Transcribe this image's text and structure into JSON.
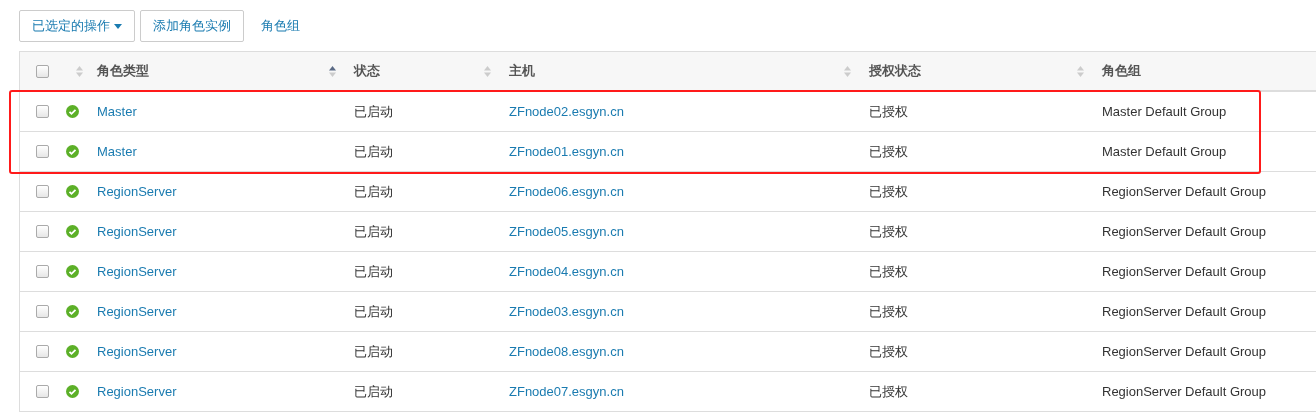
{
  "toolbar": {
    "actions_dropdown": "已选定的操作",
    "add_button": "添加角色实例",
    "group_link": "角色组"
  },
  "table": {
    "select_all_checked": false,
    "columns": [
      {
        "sorted": false
      },
      {
        "label": "角色类型",
        "sorted": true
      },
      {
        "label": "状态",
        "sorted": false
      },
      {
        "label": "主机",
        "sorted": false
      },
      {
        "label": "授权状态",
        "sorted": false
      },
      {
        "label": "角色组"
      }
    ],
    "rows": [
      {
        "checked": false,
        "healthy": true,
        "role_type": "Master",
        "state": "已启动",
        "host": "ZFnode02.esgyn.cn",
        "auth": "已授权",
        "group": "Master Default Group",
        "highlighted": true
      },
      {
        "checked": false,
        "healthy": true,
        "role_type": "Master",
        "state": "已启动",
        "host": "ZFnode01.esgyn.cn",
        "auth": "已授权",
        "group": "Master Default Group",
        "highlighted": true
      },
      {
        "checked": false,
        "healthy": true,
        "role_type": "RegionServer",
        "state": "已启动",
        "host": "ZFnode06.esgyn.cn",
        "auth": "已授权",
        "group": "RegionServer Default Group",
        "highlighted": false
      },
      {
        "checked": false,
        "healthy": true,
        "role_type": "RegionServer",
        "state": "已启动",
        "host": "ZFnode05.esgyn.cn",
        "auth": "已授权",
        "group": "RegionServer Default Group",
        "highlighted": false
      },
      {
        "checked": false,
        "healthy": true,
        "role_type": "RegionServer",
        "state": "已启动",
        "host": "ZFnode04.esgyn.cn",
        "auth": "已授权",
        "group": "RegionServer Default Group",
        "highlighted": false
      },
      {
        "checked": false,
        "healthy": true,
        "role_type": "RegionServer",
        "state": "已启动",
        "host": "ZFnode03.esgyn.cn",
        "auth": "已授权",
        "group": "RegionServer Default Group",
        "highlighted": false
      },
      {
        "checked": false,
        "healthy": true,
        "role_type": "RegionServer",
        "state": "已启动",
        "host": "ZFnode08.esgyn.cn",
        "auth": "已授权",
        "group": "RegionServer Default Group",
        "highlighted": false
      },
      {
        "checked": false,
        "healthy": true,
        "role_type": "RegionServer",
        "state": "已启动",
        "host": "ZFnode07.esgyn.cn",
        "auth": "已授权",
        "group": "RegionServer Default Group",
        "highlighted": false
      }
    ]
  }
}
